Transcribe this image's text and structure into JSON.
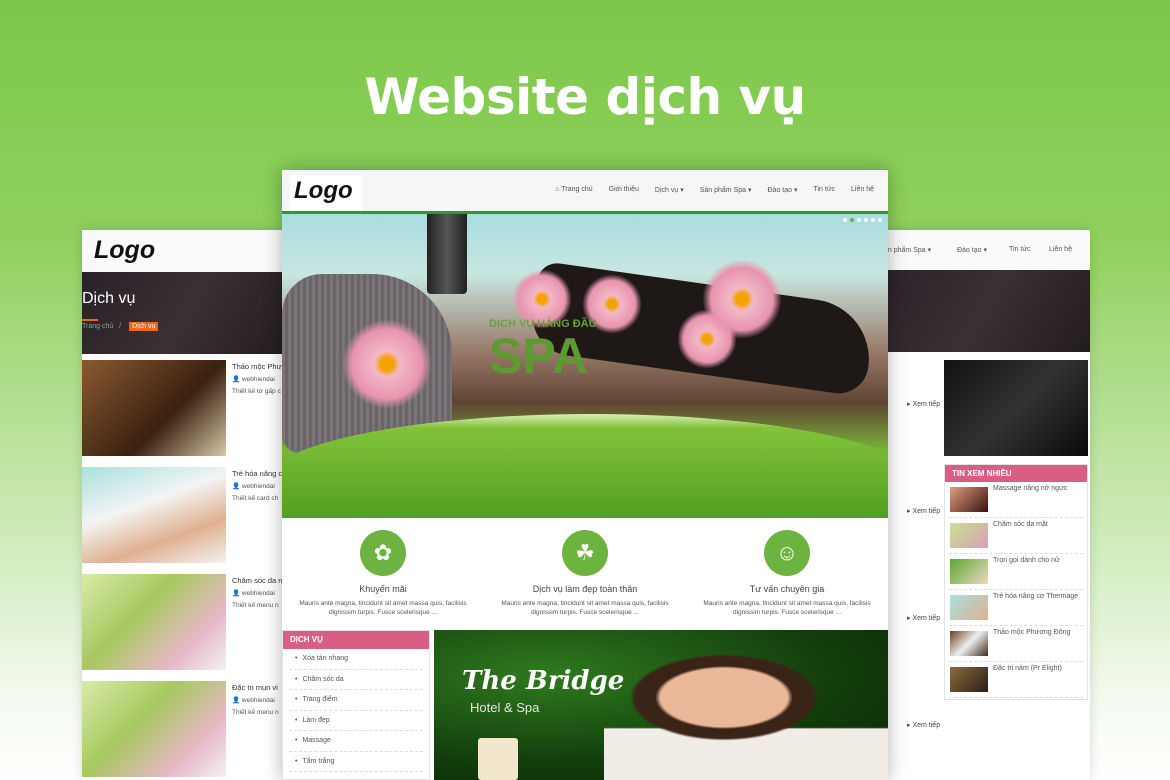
{
  "headline": "Website dịch vụ",
  "logo": "Logo",
  "nav": [
    "Trang chủ",
    "Giới thiệu",
    "Dịch vụ ▾",
    "Sản phẩm Spa ▾",
    "Đào tạo ▾",
    "Tin tức",
    "Liên hệ"
  ],
  "nav_home_icon": "home-icon",
  "hero": {
    "subtitle": "DỊCH VỤ HÀNG ĐẦU",
    "title": "SPA"
  },
  "features": [
    {
      "icon": "cream-jar-icon",
      "glyph": "✿",
      "title": "Khuyến mãi",
      "desc": "Mauris ante magna, tincidunt sit amet massa quis, facilisis dignissim turpis. Fusce scelerisque ..."
    },
    {
      "icon": "head-flower-icon",
      "glyph": "☘",
      "title": "Dịch vụ làm đẹp toàn thân",
      "desc": "Mauris ante magna, tincidunt sit amet massa quis, facilisis dignissim turpis. Fusce scelerisque ..."
    },
    {
      "icon": "consultant-icon",
      "glyph": "☺",
      "title": "Tư vấn chuyên gia",
      "desc": "Mauris ante magna, tincidunt sit amet massa quis, facilisis dignissim turpis. Fusce scelerisque ..."
    }
  ],
  "services": {
    "title": "DỊCH VỤ",
    "items": [
      "Xóa tàn nhang",
      "Chăm sóc da",
      "Trang điểm",
      "Làm đẹp",
      "Massage",
      "Tắm trắng"
    ]
  },
  "promo": {
    "title": "The Bridge",
    "subtitle": "Hotel & Spa"
  },
  "left_page": {
    "title": "Dịch vụ",
    "breadcrumb_home": "Trang chủ",
    "breadcrumb_sep": "/",
    "breadcrumb_current": "Dịch vụ",
    "posts": [
      {
        "title": "Thảo mộc Phư",
        "author": "webhiendai",
        "excerpt": "Thiết kế tờ gấp c"
      },
      {
        "title": "Trẻ hóa nâng c",
        "author": "webhiendai",
        "excerpt": "Thiết kế card ch"
      },
      {
        "title": "Chăm sóc da n",
        "author": "webhiendai",
        "excerpt": "Thiết kế menu n"
      },
      {
        "title": "Đặc trị mụn vi",
        "author": "webhiendai",
        "excerpt": "Thiết kế menu n"
      }
    ]
  },
  "right_page": {
    "nav": [
      "ản phẩm Spa ▾",
      "Đào tạo ▾",
      "Tin tức",
      "Liên hệ"
    ],
    "more": "Xem tiếp",
    "popular": {
      "title": "TIN XEM NHIỀU",
      "items": [
        "Massage nâng nở ngực",
        "Chăm sóc da mặt",
        "Trọn gọi dành cho nữ",
        "Trẻ hóa nâng cơ Thermage",
        "Thảo mộc Phương Đông",
        "Đặc trị nám (Pr Elight)"
      ]
    }
  },
  "colors": {
    "accent_green": "#6db33f",
    "pink": "#d95e84",
    "orange": "#e8661e"
  }
}
